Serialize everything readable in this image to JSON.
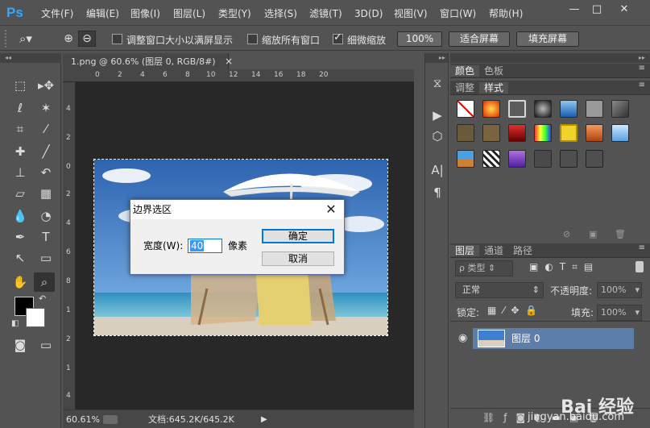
{
  "app": {
    "logo": "Ps",
    "menu": [
      "文件(F)",
      "编辑(E)",
      "图像(I)",
      "图层(L)",
      "类型(Y)",
      "选择(S)",
      "滤镜(T)",
      "3D(D)",
      "视图(V)",
      "窗口(W)",
      "帮助(H)"
    ],
    "window_buttons": {
      "minimize": "—",
      "maximize": "□",
      "close": "✕"
    }
  },
  "options": {
    "resize_windows_label": "调整窗口大小以满屏显示",
    "resize_windows_checked": false,
    "zoom_all_label": "缩放所有窗口",
    "zoom_all_checked": false,
    "scrubby_zoom_label": "细微缩放",
    "scrubby_zoom_checked": true,
    "zoom_100_label": "100%",
    "fit_screen_label": "适合屏幕",
    "fill_screen_label": "填充屏幕"
  },
  "document": {
    "tab_title": "1.png @ 60.6% (图层 0, RGB/8#)",
    "tab_close": "×",
    "ruler_top": [
      "0",
      "2",
      "4",
      "6",
      "8",
      "10",
      "12",
      "14",
      "16",
      "18",
      "20"
    ],
    "ruler_left": [
      "4",
      "2",
      "0",
      "2",
      "4",
      "6",
      "8",
      "1",
      "2",
      "1",
      "4"
    ],
    "zoom_level": "60.61%",
    "doc_info": "文档:645.2K/645.2K"
  },
  "dialog": {
    "title": "边界选区",
    "close": "✕",
    "width_label": "宽度(W):",
    "width_value": "40",
    "unit_label": "像素",
    "ok_label": "确定",
    "cancel_label": "取消"
  },
  "panels": {
    "tabs_top": [
      "颜色",
      "色板"
    ],
    "tabs_style": [
      "调整",
      "样式"
    ],
    "tabs_layers": [
      "图层",
      "通道",
      "路径"
    ],
    "filter_kind": "ρ 类型",
    "blend_mode": "正常",
    "opacity_label": "不透明度:",
    "opacity_value": "100%",
    "lock_label": "锁定:",
    "fill_label": "填充:",
    "fill_value": "100%",
    "layer_name": "图层 0"
  },
  "watermark": {
    "text": "Bai 经验",
    "sub": "jingyan.baidu.com"
  }
}
